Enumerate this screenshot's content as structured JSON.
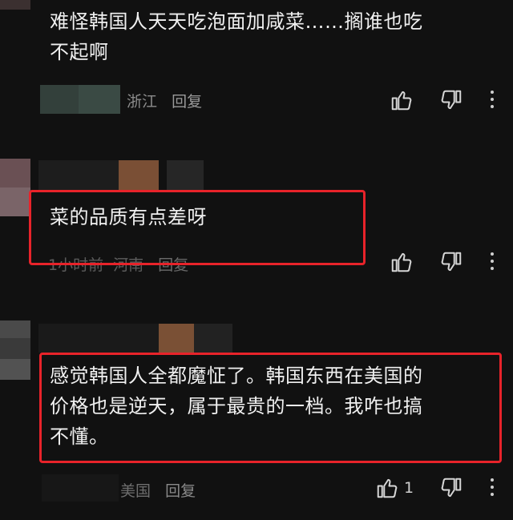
{
  "comments": [
    {
      "text_line1": "难怪韩国人天天吃泡面加咸菜……搁谁也吃",
      "text_line2": "不起啊",
      "meta_location": "浙江",
      "meta_reply": "回复",
      "like_count": ""
    },
    {
      "text_line1": "菜的品质有点差呀",
      "meta_time": "1小时前",
      "meta_location": "河南",
      "meta_reply": "回复",
      "like_count": ""
    },
    {
      "text_line1": "感觉韩国人全都魔怔了。韩国东西在美国的",
      "text_line2": "价格也是逆天，属于最贵的一档。我咋也搞",
      "text_line3": "不懂。",
      "meta_location": "美国",
      "meta_reply": "回复",
      "like_count": "1"
    }
  ],
  "icons": {
    "like": "thumbs-up-icon",
    "dislike": "thumbs-down-icon",
    "more": "more-vertical-icon"
  },
  "colors": {
    "background": "#111111",
    "highlight": "#e8232a",
    "meta_text": "#8c8c8c"
  }
}
